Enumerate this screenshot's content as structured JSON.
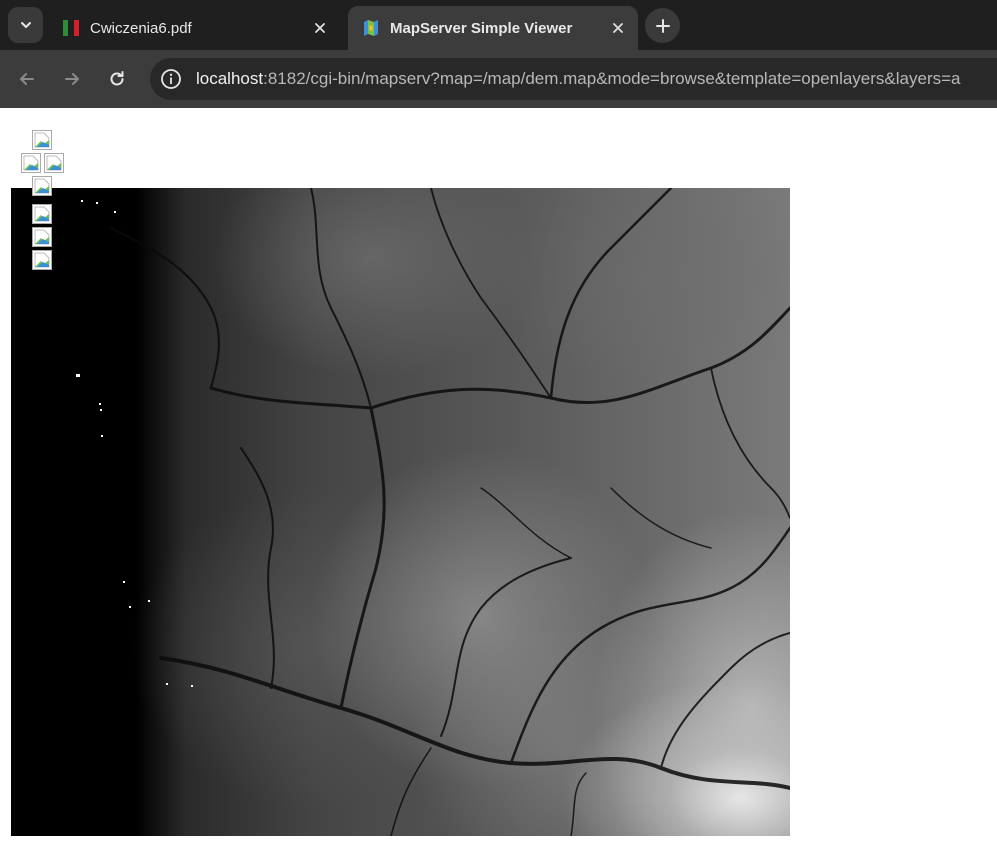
{
  "browser": {
    "tabs": [
      {
        "title": "Cwiczenia6.pdf",
        "active": false,
        "icon": "pdf-icon"
      },
      {
        "title": "MapServer Simple Viewer",
        "active": true,
        "icon": "mapserver-icon"
      }
    ],
    "url_host": "localhost",
    "url_rest": ":8182/cgi-bin/mapserv?map=/map/dem.map&mode=browse&template=openlayers&layers=a"
  },
  "map": {
    "name": "dem",
    "mode": "browse",
    "template": "openlayers",
    "rendering": "grayscale-elevation-raster",
    "navigation_controls": [
      {
        "icon": "pan-north-icon"
      },
      {
        "icon": "pan-west-icon"
      },
      {
        "icon": "pan-east-icon"
      },
      {
        "icon": "pan-south-icon"
      },
      {
        "icon": "zoom-in-icon"
      },
      {
        "icon": "zoom-world-icon"
      },
      {
        "icon": "zoom-out-icon"
      }
    ]
  },
  "colors": {
    "tabstrip_bg": "#1f1f1f",
    "toolbar_bg": "#3c3c3c",
    "omnibox_bg": "#282828",
    "page_bg": "#ffffff",
    "broken_image_border": "#a9a9a9"
  }
}
